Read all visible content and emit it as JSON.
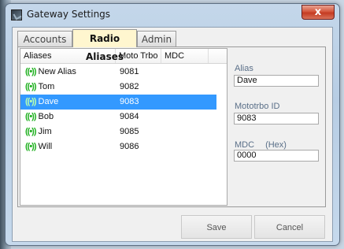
{
  "window": {
    "title": "Gateway Settings",
    "close_label": "x"
  },
  "tabs": [
    {
      "label": "Accounts",
      "active": false
    },
    {
      "label": "Radio Aliases",
      "active": true
    },
    {
      "label": "Admin",
      "active": false
    }
  ],
  "alias_list": {
    "columns": [
      "Aliases",
      "Moto Trbo",
      "MDC"
    ],
    "rows": [
      {
        "icon": "((•))",
        "alias": "New Alias",
        "moto_trbo": "9081",
        "mdc": "",
        "selected": false
      },
      {
        "icon": "((•))",
        "alias": "Tom",
        "moto_trbo": "9082",
        "mdc": "",
        "selected": false
      },
      {
        "icon": "((•))",
        "alias": "Dave",
        "moto_trbo": "9083",
        "mdc": "",
        "selected": true
      },
      {
        "icon": "((•))",
        "alias": "Bob",
        "moto_trbo": "9084",
        "mdc": "",
        "selected": false
      },
      {
        "icon": "((•))",
        "alias": "Jim",
        "moto_trbo": "9085",
        "mdc": "",
        "selected": false
      },
      {
        "icon": "((•))",
        "alias": "Will",
        "moto_trbo": "9086",
        "mdc": "",
        "selected": false
      }
    ]
  },
  "details": {
    "alias_label": "Alias",
    "alias_value": "Dave",
    "mototrbo_label": "Mototrbo ID",
    "mototrbo_value": "9083",
    "mdc_label": "MDC",
    "mdc_hex_label": "(Hex)",
    "mdc_value": "0000"
  },
  "buttons": {
    "save": "Save",
    "cancel": "Cancel"
  },
  "colors": {
    "selection": "#3399ff",
    "active_tab": "#fff6cf",
    "radio_icon": "#20b020"
  }
}
